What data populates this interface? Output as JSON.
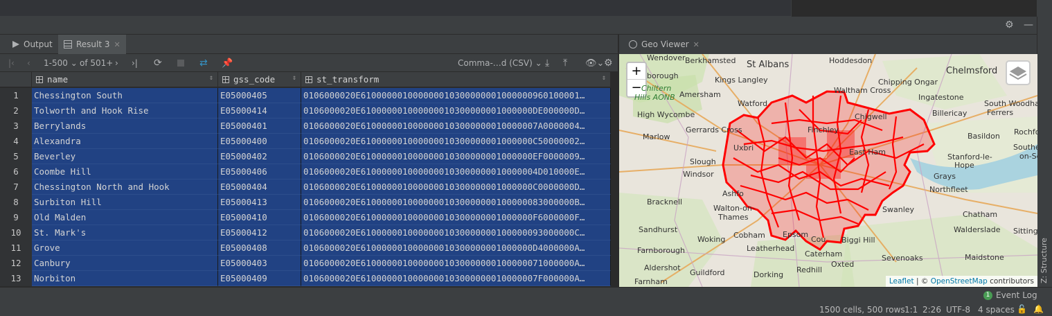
{
  "panel_tabs": [
    {
      "label": "Output"
    },
    {
      "label": "Result 3"
    }
  ],
  "geo_tab": {
    "label": "Geo Viewer"
  },
  "toolbar": {
    "page_range": "1-500",
    "page_total": "of 501+",
    "export_format": "Comma-…d (CSV)"
  },
  "columns": [
    {
      "name": "name"
    },
    {
      "name": "gss_code"
    },
    {
      "name": "st_transform"
    }
  ],
  "rows": [
    {
      "n": "1",
      "name": "Chessington South",
      "gss": "E05000405",
      "geom": "0106000020E610000001000000010300000001000000960100001…"
    },
    {
      "n": "2",
      "name": "Tolworth and Hook Rise",
      "gss": "E05000414",
      "geom": "0106000020E610000001000000010300000001000000DE000000D…"
    },
    {
      "n": "3",
      "name": "Berrylands",
      "gss": "E05000401",
      "geom": "0106000020E6100000010000000103000000010000007A0000004…"
    },
    {
      "n": "4",
      "name": "Alexandra",
      "gss": "E05000400",
      "geom": "0106000020E610000001000000010300000001000000C50000002…"
    },
    {
      "n": "5",
      "name": "Beverley",
      "gss": "E05000402",
      "geom": "0106000020E610000001000000010300000001000000EF0000009…"
    },
    {
      "n": "6",
      "name": "Coombe Hill",
      "gss": "E05000406",
      "geom": "0106000020E6100000010000000103000000010000004D010000E…"
    },
    {
      "n": "7",
      "name": "Chessington North and Hook",
      "gss": "E05000404",
      "geom": "0106000020E610000001000000010300000001000000C0000000D…"
    },
    {
      "n": "8",
      "name": "Surbiton Hill",
      "gss": "E05000413",
      "geom": "0106000020E61000000100000001030000000100000083000000B…"
    },
    {
      "n": "9",
      "name": "Old Malden",
      "gss": "E05000410",
      "geom": "0106000020E610000001000000010300000001000000F6000000F…"
    },
    {
      "n": "10",
      "name": "St. Mark's",
      "gss": "E05000412",
      "geom": "0106000020E61000000100000001030000000100000093000000C…"
    },
    {
      "n": "11",
      "name": "Grove",
      "gss": "E05000408",
      "geom": "0106000020E610000001000000010300000001000000D4000000A…"
    },
    {
      "n": "12",
      "name": "Canbury",
      "gss": "E05000403",
      "geom": "0106000020E61000000100000001030000000100000071000000A…"
    },
    {
      "n": "13",
      "name": "Norbiton",
      "gss": "E05000409",
      "geom": "0106000020E6100000010000000103000000010000007F000000A…"
    }
  ],
  "map": {
    "zoom_in": "+",
    "zoom_out": "−",
    "attribution_leaflet": "Leaflet",
    "attribution_sep": " | © ",
    "attribution_osm": "OpenStreetMap",
    "attribution_tail": " contributors",
    "polygon_color": "#ff0000",
    "labels": {
      "wendover": "Wendover",
      "berkhamsted": "Berkhamsted",
      "st_albans": "St Albans",
      "hoddesdon": "Hoddesdon",
      "chelmsford": "Chelmsford",
      "borough": "borough",
      "kings_langley": "Kings Langley",
      "chipping_ongar": "Chipping Ongar",
      "chiltern": "Chiltern",
      "hills_aonb": "Hills AONB",
      "amersham": "Amersham",
      "waltham_cross": "Waltham Cross",
      "ingatestone": "Ingatestone",
      "south_woodham": "South Woodham",
      "ferrers": "Ferrers",
      "high_wycombe": "High Wycombe",
      "watford": "Watford",
      "billericay": "Billericay",
      "chigwell": "Chigwell",
      "gerrards_cross": "Gerrards Cross",
      "finchley": "Finchley",
      "marlow": "Marlow",
      "basildon": "Basildon",
      "rochford": "Rochford",
      "uxbridge": "Uxbri",
      "east_ham": "East Ham",
      "southend": "Southen",
      "on_sea": "on-Se",
      "slough": "Slough",
      "stanford": "Stanford-le-",
      "hope": "Hope",
      "windsor": "Windsor",
      "grays": "Grays",
      "northfleet": "Northfleet",
      "bracknell": "Bracknell",
      "ashford": "Ashfo",
      "walton": "Walton-on-",
      "thames": "Thames",
      "swanley": "Swanley",
      "chatham": "Chatham",
      "sandhurst": "Sandhurst",
      "walderslade": "Walderslade",
      "sittingbourne": "Sittingb",
      "cobham": "Cobham",
      "woking": "Woking",
      "farnborough": "Farnborough",
      "leatherhead": "Leatherhead",
      "epsom": "Epsom",
      "coulsdon": "Cou",
      "biggin_hill": "Biggi Hill",
      "aldershot": "Aldershot",
      "caterham": "Caterham",
      "sevenoaks": "Sevenoaks",
      "maidstone": "Maidstone",
      "guildford": "Guildford",
      "oxted": "Oxted",
      "farnham": "Farnham",
      "dorking": "Dorking",
      "redhill": "Redhill"
    }
  },
  "status": {
    "event_log_count": "1",
    "event_log": "Event Log",
    "cells": "1500 cells, 500 rows",
    "cursor": "1:1",
    "col": "2:26",
    "encoding": "UTF-8",
    "indent": "4 spaces",
    "structure": "Z: Structure"
  }
}
